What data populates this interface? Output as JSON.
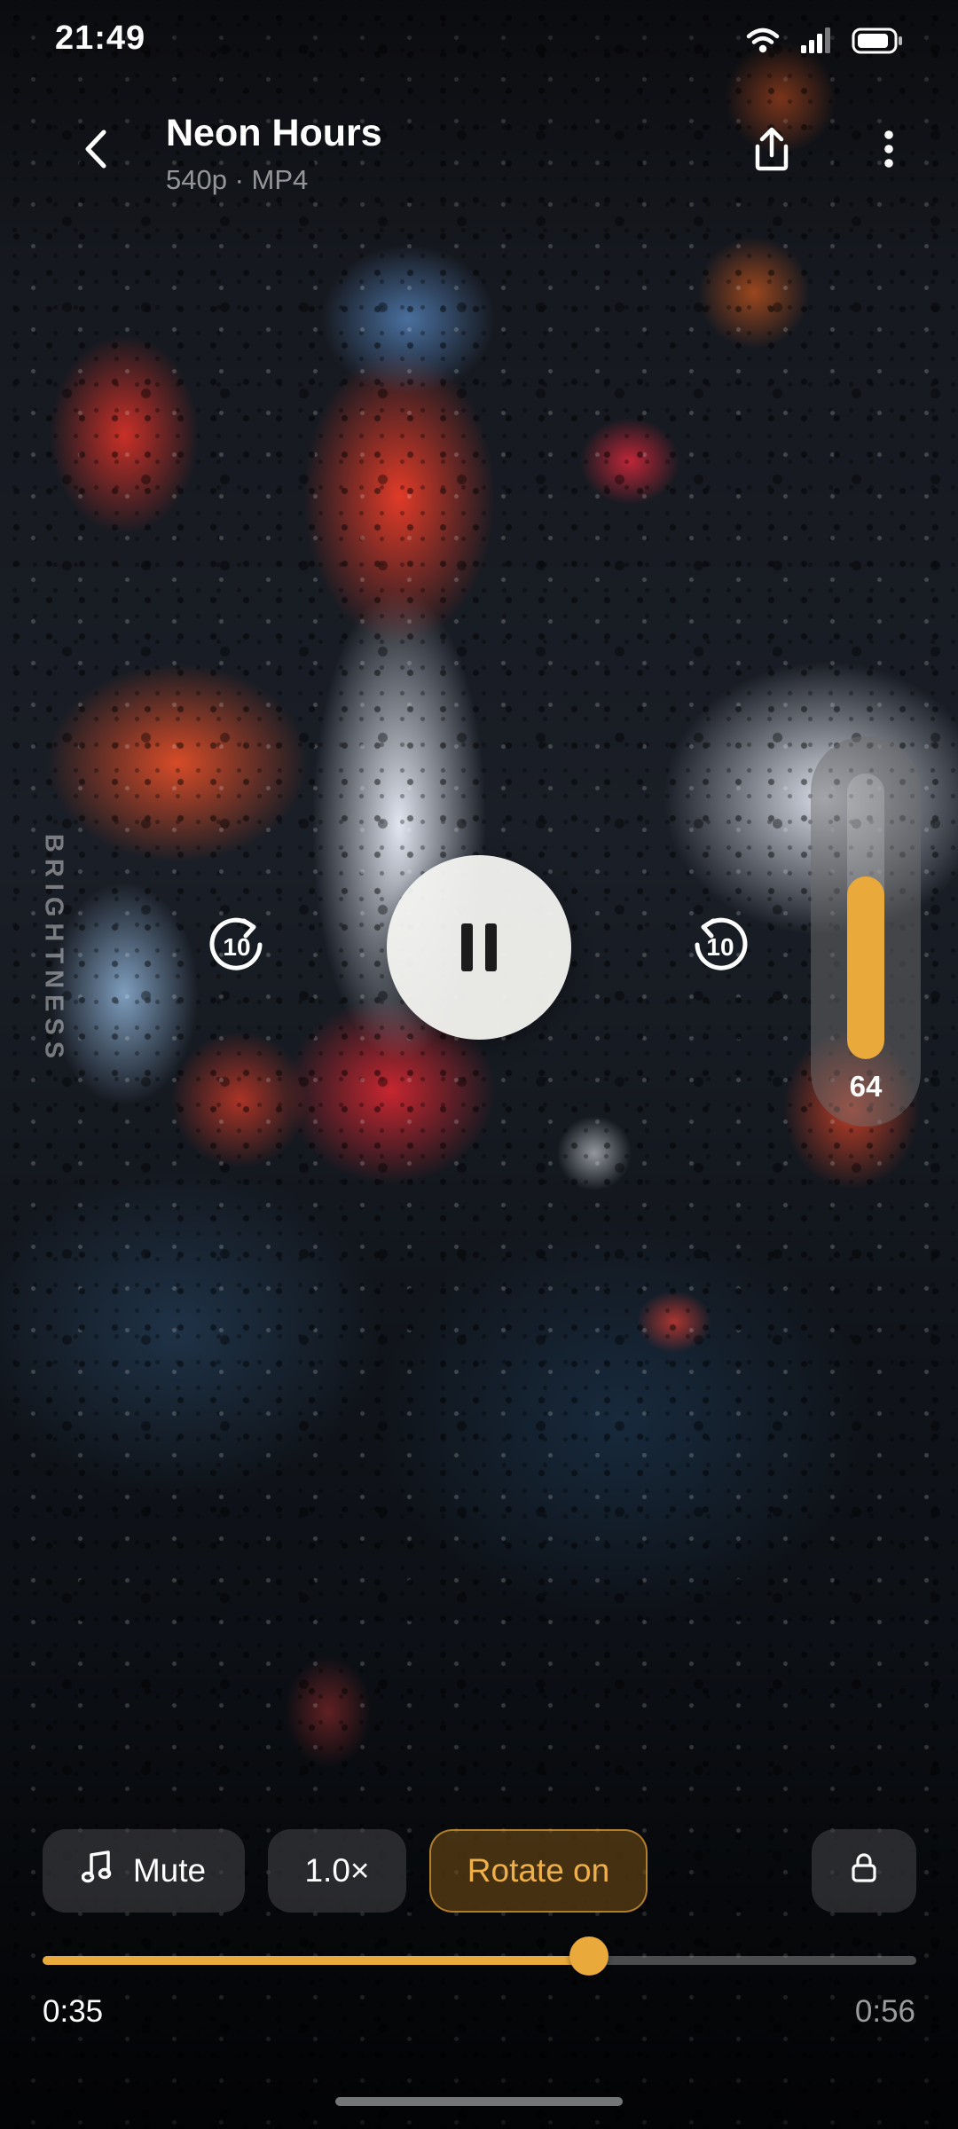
{
  "status_bar": {
    "time": "21:49",
    "icons": [
      "wifi-icon",
      "cellular-signal-icon",
      "battery-icon"
    ]
  },
  "header": {
    "title": "Neon Hours",
    "meta": "540p · MP4",
    "icons": [
      "back-chevron-icon",
      "share-upload-icon",
      "more-vertical-icon"
    ]
  },
  "gestures": {
    "brightness_label": "BRIGHTNESS"
  },
  "playback": {
    "state": "playing",
    "skip_back_seconds": "10",
    "skip_forward_seconds": "10",
    "icons": [
      "replay-10-icon",
      "pause-icon",
      "forward-10-icon"
    ]
  },
  "volume": {
    "value": "64",
    "level": 0.64
  },
  "chips": {
    "mute_label": "Mute",
    "speed_label": "1.0×",
    "rotate_label": "Rotate on",
    "icons": [
      "music-note-icon",
      "lock-icon"
    ]
  },
  "progress": {
    "current": "0:35",
    "total": "0:56",
    "fraction": 0.625
  },
  "colors": {
    "accent": "#e9a93b",
    "chip_background": "#464648",
    "play_button": "#f3f3f0"
  }
}
